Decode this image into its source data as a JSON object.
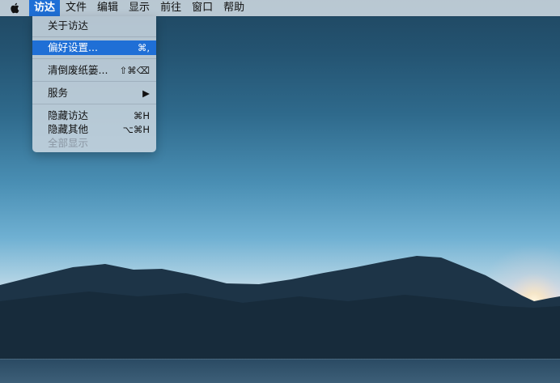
{
  "menubar": {
    "apple_icon": "apple-logo-icon",
    "items": [
      "访达",
      "文件",
      "编辑",
      "显示",
      "前往",
      "窗口",
      "帮助"
    ],
    "active_index": 0
  },
  "dropdown": {
    "about": "关于访达",
    "preferences": {
      "label": "偏好设置...",
      "shortcut": "⌘,"
    },
    "empty_trash": {
      "label": "清倒废纸篓...",
      "shortcut": "⇧⌘⌫"
    },
    "services": {
      "label": "服务",
      "arrow": "▶"
    },
    "hide": {
      "label": "隐藏访达",
      "shortcut": "⌘H"
    },
    "hide_others": {
      "label": "隐藏其他",
      "shortcut": "⌥⌘H"
    },
    "show_all": "全部显示"
  },
  "colors": {
    "selection": "#1f6fd6",
    "menubar_bg": "#dce4ec"
  }
}
